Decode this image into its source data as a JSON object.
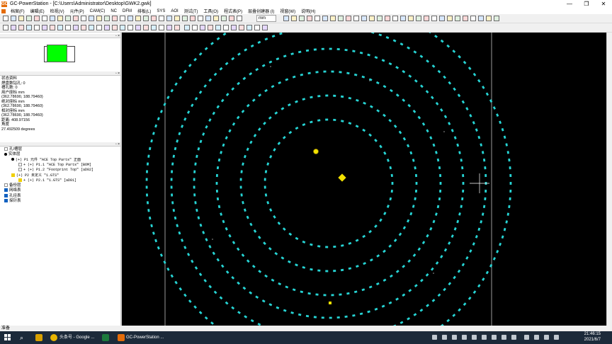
{
  "window": {
    "title": "GC-PowerStation - [C:\\Users\\Administrator\\Desktop\\GWK2.gwk]",
    "app_icon": "GC",
    "buttons": [
      "—",
      "❐",
      "✕"
    ]
  },
  "menu": {
    "items": [
      "档案(F)",
      "编辑(E)",
      "检视(V)",
      "元件(P)",
      "CAM(C)",
      "NC",
      "DFM",
      "排板(L)",
      "SYS",
      "AOI",
      "测试(T)",
      "工具(O)",
      "程式表(P)",
      "层叠创建器 (I)",
      "视窗(W)",
      "说明(H)"
    ]
  },
  "toolbar": {
    "unit_select": "mm"
  },
  "left_panel": {
    "info_title": "状态资料",
    "info_lines": [
      "状态资料",
      "焊盘数钻孔: 0",
      "槽孔数: 0",
      "用户座标 mm",
      "(362.78690, 188.79460)",
      "绝对座标 mm",
      "(362.78690, 188.79460)",
      "相对座标 mm",
      "(362.78690, 188.79460)",
      "距离: 408.97156",
      "角度",
      "27.492509 degrees"
    ],
    "tree": [
      {
        "indent": 0,
        "marker": "box",
        "text": "孔/槽层"
      },
      {
        "indent": 0,
        "marker": "bul",
        "text": "实体层"
      },
      {
        "indent": 1,
        "marker": "bul",
        "text": "(+) P1 元件 \"ACE Top Parts\" 正面",
        "mono": true
      },
      {
        "indent": 2,
        "marker": "box",
        "text": "+ (+) P1.1 \"ACE Top Parts\" [BOM]",
        "mono": true
      },
      {
        "indent": 2,
        "marker": "box",
        "text": "+ (+) P1.2 \"Footprint Top\" [aD02]",
        "mono": true
      },
      {
        "indent": 1,
        "marker": "ybox",
        "text": "(+) P2 未定义 \"1.GTS\"",
        "mono": true
      },
      {
        "indent": 2,
        "marker": "ybox",
        "text": "+ (+) P2.1 \"1.GTS\" [aD01]",
        "mono": true
      },
      {
        "indent": 0,
        "marker": "box",
        "text": "备份层"
      },
      {
        "indent": 0,
        "marker": "blue",
        "text": "网络表"
      },
      {
        "indent": 0,
        "marker": "blue",
        "text": "孔径表"
      },
      {
        "indent": 0,
        "marker": "blue",
        "text": "探针表"
      }
    ]
  },
  "status_bar": {
    "text": "准备"
  },
  "taskbar": {
    "apps": [
      {
        "label": "头条号 - Google ...",
        "color": "#e8b400"
      },
      {
        "label": "",
        "color": "#1d7a3d"
      },
      {
        "label": "GC-PowerStation ...",
        "color": "#e46c0a"
      }
    ],
    "time": "21:46:15",
    "date": "2021/6/7"
  },
  "colors": {
    "pad": "#26d4d4",
    "canvas_bg": "#000000",
    "highlight_pad": "#f2e100",
    "board_border": "#9a9a9a"
  }
}
